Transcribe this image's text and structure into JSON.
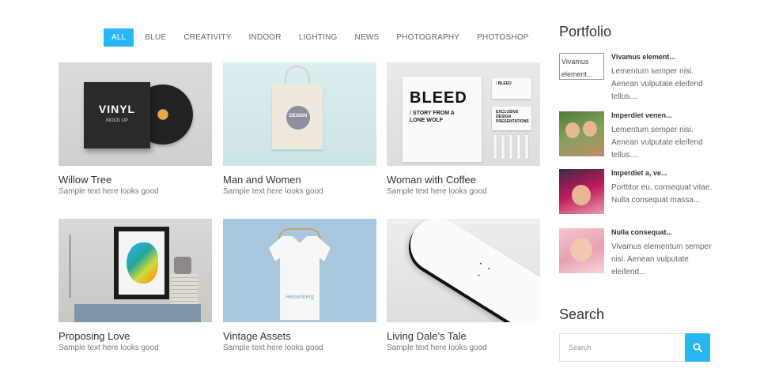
{
  "filters": [
    {
      "label": "ALL",
      "active": true
    },
    {
      "label": "BLUE",
      "active": false
    },
    {
      "label": "CREATIVITY",
      "active": false
    },
    {
      "label": "INDOOR",
      "active": false
    },
    {
      "label": "LIGHTING",
      "active": false
    },
    {
      "label": "NEWS",
      "active": false
    },
    {
      "label": "PHOTOGRAPHY",
      "active": false
    },
    {
      "label": "PHOTOSHOP",
      "active": false
    }
  ],
  "gallery": [
    {
      "title": "Willow Tree",
      "subtitle": "Sample text here looks good"
    },
    {
      "title": "Man and Women",
      "subtitle": "Sample text here looks good"
    },
    {
      "title": "Woman with Coffee",
      "subtitle": "Sample text here looks good"
    },
    {
      "title": "Proposing Love",
      "subtitle": "Sample text here looks good"
    },
    {
      "title": "Vintage Assets",
      "subtitle": "Sample text here looks good"
    },
    {
      "title": "Living Dale’s Tale",
      "subtitle": "Sample text here looks good"
    }
  ],
  "thumb_text": {
    "vinyl_logo": "VINYL",
    "vinyl_sub": "MOCK UP",
    "bag_logo": "DESIGN",
    "bleed_title": "BLEED",
    "bleed_sub_1": "STORY FROM A",
    "bleed_sub_2": "LONE WOLF",
    "biz_1": "BLEED",
    "biz_2": "EXCLUSIVE DESIGN PRESENTATIONS",
    "tee_logo": "Heisenberg"
  },
  "sidebar": {
    "portfolio_title": "Portfolio",
    "items": [
      {
        "alt": "Vivamus element...",
        "heading": "Vivamus element...",
        "text": "Lementum semper nisi. Aenean vulputate eleifend tellus...."
      },
      {
        "heading": "Imperdiet venen...",
        "text": "Lementum semper nisi. Aenean vulputate eleifend tellus...."
      },
      {
        "heading": "Imperdiet a, ve...",
        "text": "Porttitor eu, consequat vitae. Nulla consequat massa..."
      },
      {
        "heading": "Nulla consequat...",
        "text": "Vivamus elementum semper nisi. Aenean vulputate eleifend..."
      }
    ],
    "search_title": "Search",
    "search_placeholder": "Search"
  },
  "colors": {
    "accent": "#29b6f6"
  }
}
